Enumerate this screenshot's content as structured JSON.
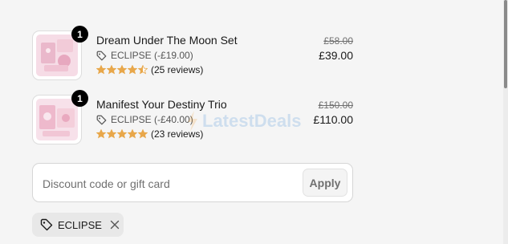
{
  "cart": {
    "items": [
      {
        "title": "Dream Under The Moon Set",
        "quantity": "1",
        "discount": "ECLIPSE (-£19.00)",
        "rating": 4.5,
        "reviews": "(25 reviews)",
        "compare_price": "£58.00",
        "price": "£39.00"
      },
      {
        "title": "Manifest Your Destiny Trio",
        "quantity": "1",
        "discount": "ECLIPSE (-£40.00)",
        "rating": 5,
        "reviews": "(23 reviews)",
        "compare_price": "£150.00",
        "price": "£110.00"
      }
    ]
  },
  "discount_form": {
    "placeholder": "Discount code or gift card",
    "apply_label": "Apply"
  },
  "applied_code": {
    "label": "ECLIPSE"
  },
  "watermark": {
    "text": "LatestDeals"
  },
  "colors": {
    "star": "#e8a74a",
    "badge": "#000000",
    "chip_bg": "#e8e8e8"
  },
  "icons": [
    "tag-icon",
    "star-icon",
    "close-icon"
  ]
}
